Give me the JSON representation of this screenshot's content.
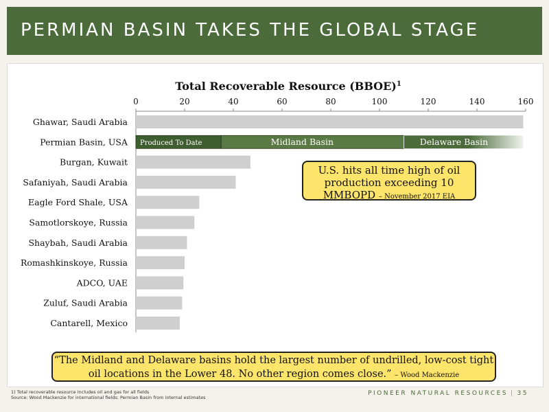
{
  "header": {
    "title": "PERMIAN BASIN TAKES THE GLOBAL STAGE"
  },
  "callout": {
    "line": "U.S. hits all time high of oil production exceeding 10 MMBOPD",
    "source": "– November 2017 EIA"
  },
  "quote": {
    "text": "“The Midland and Delaware basins hold the largest number of undrilled, low-cost tight oil locations in the Lower 48. No other region comes close.”",
    "attribution": "– Wood Mackenzie"
  },
  "footnote": {
    "line1": "1) Total recoverable resource includes oil and gas for all fields",
    "line2": "Source: Wood Mackenzie for international fields; Permian Basin from internal estimates"
  },
  "brand": {
    "name": "PIONEER NATURAL RESOURCES",
    "separator": "|",
    "page": "35"
  },
  "colors": {
    "header": "#4b6b3a",
    "bar": "#cfcfcf",
    "callout": "#fde46a",
    "segment_dark": "#3f5e2f",
    "segment_mid": "#5a7a45",
    "segment_light": "#4b6b3a"
  },
  "chart_data": {
    "type": "bar",
    "orientation": "horizontal",
    "title": "Total Recoverable Resource (BBOE)",
    "title_superscript": "1",
    "xlim": [
      0,
      160
    ],
    "xticks": [
      0,
      20,
      40,
      60,
      80,
      100,
      120,
      140,
      160
    ],
    "axis_position": "top",
    "grid": false,
    "categories": [
      "Ghawar, Saudi Arabia",
      "Permian Basin, USA",
      "Burgan, Kuwait",
      "Safaniyah, Saudi Arabia",
      "Eagle Ford Shale, USA",
      "Samotlorskoye, Russia",
      "Shaybah, Saudi Arabia",
      "Romashkinskoye, Russia",
      "ADCO, UAE",
      "Zuluf, Saudi Arabia",
      "Cantarell, Mexico"
    ],
    "values": [
      159,
      159,
      47,
      41,
      26,
      24,
      21,
      20,
      19.5,
      19,
      18
    ],
    "stacked_segments": {
      "category": "Permian Basin, USA",
      "segments": [
        {
          "name": "Produced To Date",
          "value": 35
        },
        {
          "name": "Midland Basin",
          "value": 75
        },
        {
          "name": "Delaware Basin",
          "value": 49
        }
      ]
    }
  }
}
